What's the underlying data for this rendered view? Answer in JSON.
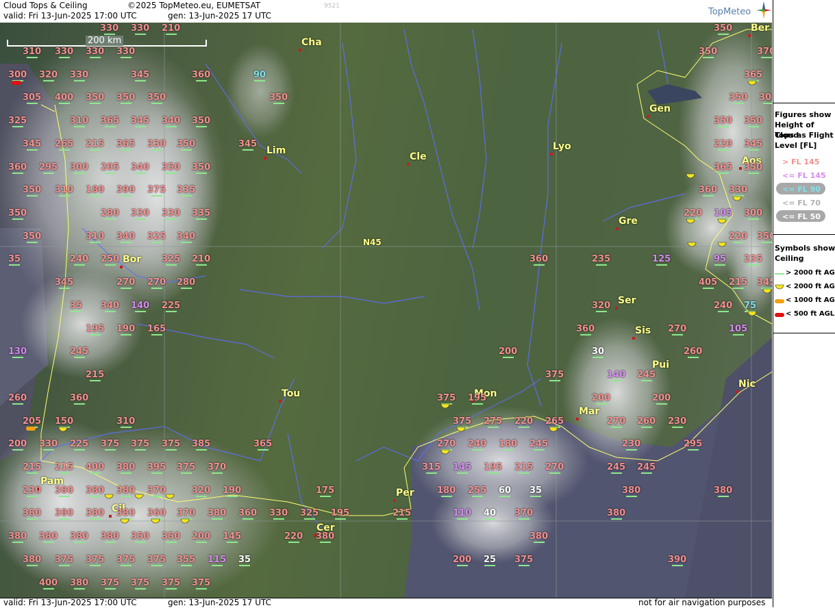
{
  "header": {
    "title": "Cloud Tops & Ceiling",
    "copyright": "©2025 TopMeteo.eu, EUMETSAT",
    "code": "9521",
    "valid": "valid:  Fri  13-Jun-2025  17:00 UTC",
    "gen": "gen: 13-Jun-2025 17 UTC",
    "logo": "TopMeteo"
  },
  "footer": {
    "valid": "valid:  Fri  13-Jun-2025  17:00 UTC",
    "gen": "gen: 13-Jun-2025 17 UTC",
    "disclaimer": "not for air navigation purposes"
  },
  "map": {
    "scale_label": "200 km",
    "gridline_label": "N45",
    "cities": [
      "Cha",
      "Lim",
      "Cle",
      "Lyo",
      "Gen",
      "Ber",
      "Aos",
      "Gre",
      "Bor",
      "Ser",
      "Sis",
      "Pui",
      "Nic",
      "Tou",
      "Mon",
      "Mar",
      "Pam",
      "Cil",
      "Per",
      "Cer"
    ],
    "labels": [
      [
        "330",
        "p"
      ],
      [
        "330",
        "p"
      ],
      [
        "210",
        "p"
      ],
      [
        "350",
        "p"
      ],
      [
        "Ber",
        ""
      ],
      [
        "310",
        "p"
      ],
      [
        "330",
        "p"
      ],
      [
        "330",
        "p"
      ],
      [
        "330",
        "p"
      ],
      [
        "350",
        "p"
      ],
      [
        "370",
        "p"
      ],
      [
        "300",
        "p"
      ],
      [
        "320",
        "p"
      ],
      [
        "330",
        "p"
      ],
      [
        "345",
        "p"
      ],
      [
        "360",
        "p"
      ],
      [
        "90",
        "c"
      ],
      [
        "350",
        "p"
      ],
      [
        "365",
        "p"
      ],
      [
        "305",
        "p"
      ],
      [
        "400",
        "p"
      ],
      [
        "350",
        "p"
      ],
      [
        "350",
        "p"
      ],
      [
        "350",
        "p"
      ],
      [
        "350",
        "p"
      ],
      [
        "305",
        "p"
      ],
      [
        "325",
        "p"
      ],
      [
        "310",
        "p"
      ],
      [
        "365",
        "p"
      ],
      [
        "345",
        "p"
      ],
      [
        "340",
        "p"
      ],
      [
        "350",
        "p"
      ],
      [
        "350",
        "p"
      ],
      [
        "350",
        "p"
      ],
      [
        "345",
        "p"
      ],
      [
        "265",
        "p"
      ],
      [
        "215",
        "p"
      ],
      [
        "365",
        "p"
      ],
      [
        "330",
        "p"
      ],
      [
        "350",
        "p"
      ],
      [
        "345",
        "p"
      ],
      [
        "220",
        "p"
      ],
      [
        "345",
        "p"
      ],
      [
        "360",
        "p"
      ],
      [
        "295",
        "p"
      ],
      [
        "300",
        "p"
      ],
      [
        "205",
        "p"
      ],
      [
        "340",
        "p"
      ],
      [
        "350",
        "p"
      ],
      [
        "350",
        "p"
      ],
      [
        "365",
        "p"
      ],
      [
        "350",
        "p"
      ],
      [
        "350",
        "p"
      ],
      [
        "310",
        "p"
      ],
      [
        "180",
        "p"
      ],
      [
        "390",
        "p"
      ],
      [
        "375",
        "p"
      ],
      [
        "335",
        "p"
      ],
      [
        "360",
        "p"
      ],
      [
        "330",
        "p"
      ],
      [
        "350",
        "p"
      ],
      [
        "280",
        "p"
      ],
      [
        "330",
        "p"
      ],
      [
        "330",
        "p"
      ],
      [
        "335",
        "p"
      ],
      [
        "220",
        "p"
      ],
      [
        "105",
        "v"
      ],
      [
        "300",
        "p"
      ],
      [
        "350",
        "p"
      ],
      [
        "310",
        "p"
      ],
      [
        "340",
        "p"
      ],
      [
        "325",
        "p"
      ],
      [
        "340",
        "p"
      ],
      [
        "220",
        "p"
      ],
      [
        "350",
        "p"
      ],
      [
        "35",
        "p"
      ],
      [
        "240",
        "p"
      ],
      [
        "250",
        "p"
      ],
      [
        "325",
        "p"
      ],
      [
        "210",
        "p"
      ],
      [
        "360",
        "p"
      ],
      [
        "235",
        "p"
      ],
      [
        "125",
        "v"
      ],
      [
        "95",
        "v"
      ],
      [
        "235",
        "p"
      ],
      [
        "345",
        "p"
      ],
      [
        "270",
        "p"
      ],
      [
        "270",
        "p"
      ],
      [
        "280",
        "p"
      ],
      [
        "405",
        "p"
      ],
      [
        "215",
        "p"
      ],
      [
        "345",
        "p"
      ],
      [
        "35",
        "p"
      ],
      [
        "340",
        "p"
      ],
      [
        "140",
        "v"
      ],
      [
        "225",
        "p"
      ],
      [
        "320",
        "p"
      ],
      [
        "240",
        "p"
      ],
      [
        "75",
        "c"
      ],
      [
        "195",
        "p"
      ],
      [
        "190",
        "p"
      ],
      [
        "165",
        "p"
      ],
      [
        "360",
        "p"
      ],
      [
        "270",
        "p"
      ],
      [
        "105",
        "v"
      ],
      [
        "130",
        "v"
      ],
      [
        "245",
        "p"
      ],
      [
        "200",
        "p"
      ],
      [
        "30",
        "w"
      ],
      [
        "260",
        "p"
      ],
      [
        "215",
        "p"
      ],
      [
        "375",
        "p"
      ],
      [
        "140",
        "v"
      ],
      [
        "245",
        "p"
      ],
      [
        "260",
        "p"
      ],
      [
        "360",
        "p"
      ],
      [
        "375",
        "p"
      ],
      [
        "195",
        "p"
      ],
      [
        "200",
        "p"
      ],
      [
        "200",
        "p"
      ],
      [
        "205",
        "p"
      ],
      [
        "150",
        "p"
      ],
      [
        "310",
        "p"
      ],
      [
        "375",
        "p"
      ],
      [
        "275",
        "p"
      ],
      [
        "220",
        "p"
      ],
      [
        "265",
        "p"
      ],
      [
        "270",
        "p"
      ],
      [
        "260",
        "p"
      ],
      [
        "230",
        "p"
      ],
      [
        "200",
        "p"
      ],
      [
        "330",
        "p"
      ],
      [
        "225",
        "p"
      ],
      [
        "375",
        "p"
      ],
      [
        "375",
        "p"
      ],
      [
        "375",
        "p"
      ],
      [
        "385",
        "p"
      ],
      [
        "365",
        "p"
      ],
      [
        "270",
        "p"
      ],
      [
        "240",
        "p"
      ],
      [
        "180",
        "p"
      ],
      [
        "245",
        "p"
      ],
      [
        "230",
        "p"
      ],
      [
        "295",
        "p"
      ],
      [
        "215",
        "p"
      ],
      [
        "215",
        "p"
      ],
      [
        "400",
        "p"
      ],
      [
        "380",
        "p"
      ],
      [
        "395",
        "p"
      ],
      [
        "375",
        "p"
      ],
      [
        "370",
        "p"
      ],
      [
        "315",
        "p"
      ],
      [
        "145",
        "v"
      ],
      [
        "195",
        "p"
      ],
      [
        "215",
        "p"
      ],
      [
        "270",
        "p"
      ],
      [
        "245",
        "p"
      ],
      [
        "245",
        "p"
      ],
      [
        "230",
        "p"
      ],
      [
        "380",
        "p"
      ],
      [
        "380",
        "p"
      ],
      [
        "380",
        "p"
      ],
      [
        "370",
        "p"
      ],
      [
        "320",
        "p"
      ],
      [
        "190",
        "p"
      ],
      [
        "175",
        "p"
      ],
      [
        "180",
        "p"
      ],
      [
        "255",
        "p"
      ],
      [
        "60",
        "w"
      ],
      [
        "35",
        "w"
      ],
      [
        "380",
        "p"
      ],
      [
        "380",
        "p"
      ],
      [
        "380",
        "p"
      ],
      [
        "380",
        "p"
      ],
      [
        "380",
        "p"
      ],
      [
        "380",
        "p"
      ],
      [
        "360",
        "p"
      ],
      [
        "370",
        "p"
      ],
      [
        "380",
        "p"
      ],
      [
        "360",
        "p"
      ],
      [
        "330",
        "p"
      ],
      [
        "325",
        "p"
      ],
      [
        "195",
        "p"
      ],
      [
        "215",
        "p"
      ],
      [
        "110",
        "v"
      ],
      [
        "40",
        "w"
      ],
      [
        "370",
        "p"
      ],
      [
        "380",
        "p"
      ],
      [
        "380",
        "p"
      ],
      [
        "380",
        "p"
      ],
      [
        "380",
        "p"
      ],
      [
        "380",
        "p"
      ],
      [
        "350",
        "p"
      ],
      [
        "350",
        "p"
      ],
      [
        "200",
        "p"
      ],
      [
        "145",
        "p"
      ],
      [
        "220",
        "p"
      ],
      [
        "380",
        "p"
      ],
      [
        "380",
        "p"
      ],
      [
        "380",
        "p"
      ],
      [
        "375",
        "p"
      ],
      [
        "375",
        "p"
      ],
      [
        "375",
        "p"
      ],
      [
        "375",
        "p"
      ],
      [
        "355",
        "p"
      ],
      [
        "115",
        "v"
      ],
      [
        "35",
        "w"
      ],
      [
        "200",
        "p"
      ],
      [
        "25",
        "w"
      ],
      [
        "375",
        "p"
      ],
      [
        "390",
        "p"
      ],
      [
        "400",
        "p"
      ],
      [
        "380",
        "p"
      ],
      [
        "375",
        "p"
      ],
      [
        "375",
        "p"
      ],
      [
        "375",
        "p"
      ],
      [
        "375",
        "p"
      ]
    ]
  },
  "legend": {
    "figures_title": "Figures show Height of Cloud Tops as Flight Level [FL]",
    "figures_lines": [
      "Figures show",
      "Height of Cloud",
      "Tops as Flight",
      "Level  [FL]"
    ],
    "levels": [
      {
        "text": "> FL 145",
        "color": "#f48f8f"
      },
      {
        "text": "<= FL 145",
        "color": "#d78bf0"
      },
      {
        "text": "<= FL 90",
        "color": "#7fe3ec"
      },
      {
        "text": "<= FL 70",
        "color": "#b0b0b0"
      },
      {
        "text": "<= FL 50",
        "color": "#ffffff"
      }
    ],
    "symbols_lines": [
      "Symbols show",
      "Ceiling"
    ],
    "symbols": [
      {
        "text": "> 2000 ft AGL",
        "color": "#8ee88e"
      },
      {
        "text": "< 2000 ft AGL",
        "color": "#f2e422"
      },
      {
        "text": "< 1000 ft AGL",
        "color": "#f2a010"
      },
      {
        "text": "< 500 ft AGL",
        "color": "#e01010"
      }
    ]
  }
}
